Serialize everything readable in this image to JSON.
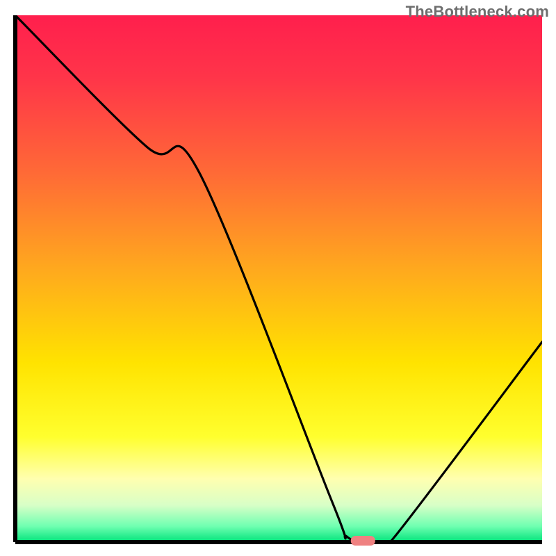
{
  "watermark": "TheBottleneck.com",
  "colors": {
    "axis": "#000000",
    "curve": "#000000",
    "marker_fill": "#ef8181",
    "marker_stroke": "#ef8181",
    "gradient_stops": [
      {
        "offset": 0.0,
        "color": "#ff1f4d"
      },
      {
        "offset": 0.12,
        "color": "#ff3549"
      },
      {
        "offset": 0.3,
        "color": "#ff6a36"
      },
      {
        "offset": 0.48,
        "color": "#ffa81e"
      },
      {
        "offset": 0.66,
        "color": "#ffe300"
      },
      {
        "offset": 0.8,
        "color": "#ffff2e"
      },
      {
        "offset": 0.88,
        "color": "#ffffb0"
      },
      {
        "offset": 0.93,
        "color": "#d8ffc7"
      },
      {
        "offset": 0.97,
        "color": "#6fffb1"
      },
      {
        "offset": 1.0,
        "color": "#00e37a"
      }
    ]
  },
  "chart_data": {
    "type": "line",
    "title": "",
    "xlabel": "",
    "ylabel": "",
    "xlim": [
      0,
      100
    ],
    "ylim": [
      0,
      100
    ],
    "series": [
      {
        "name": "bottleneck-curve",
        "x": [
          0,
          25,
          35,
          60,
          63,
          69,
          72,
          100
        ],
        "y": [
          100,
          75,
          70,
          8,
          1,
          0,
          1,
          38
        ]
      }
    ],
    "annotations": [
      {
        "name": "optimal-marker",
        "x": 66,
        "y": 0,
        "shape": "pill"
      }
    ]
  }
}
